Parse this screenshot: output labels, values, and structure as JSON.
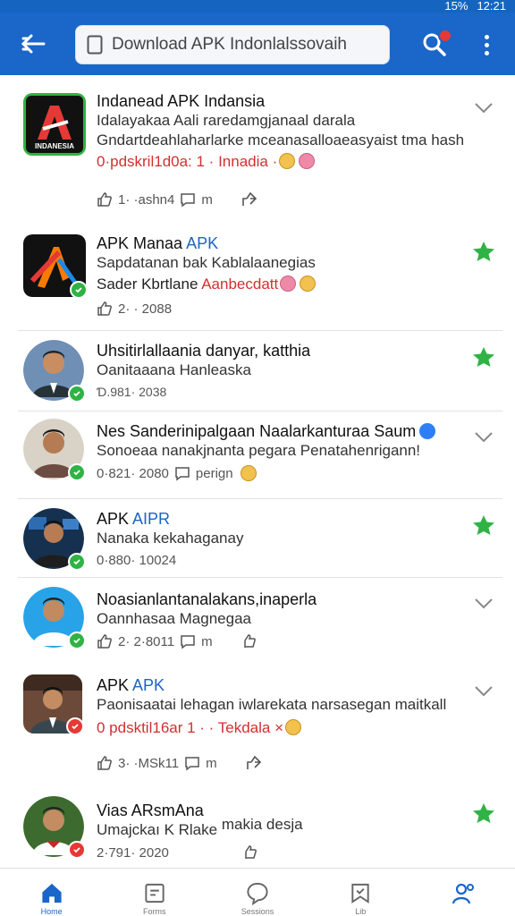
{
  "status_bar": {
    "battery": "15%",
    "time": "12:21"
  },
  "header": {
    "search_value": "Download APK Indonlalssovaih",
    "colors": {
      "bar": "#1a66c9",
      "badge": "#e53935"
    }
  },
  "feed": [
    {
      "title": "Indanead APK Indansia",
      "title_accent": "",
      "line1": "Idalayakaa Aali raredamgjanaal darala",
      "line2": "Gndartdeahlaharlarke mceanasalloaeasyaist tma hash",
      "line3": "0·pdskril1d0a: 1 · Innadia ·",
      "likes": "1· ·ashn4",
      "comments": "m",
      "logo_text": "INDANESIA",
      "right_icon": "chevron-down"
    },
    {
      "title": "APK Manaa ",
      "title_accent": "APK",
      "line1": "Sapdatanan bak Kablalaanegias",
      "line2_dark": "Sader Kbrtlane ",
      "line2_red": "Aanbecdatt",
      "likes": "2· · 2088",
      "right_icon": "star"
    },
    {
      "title": "Uhsitirlallaania danyar, katthia",
      "line1": "Oanitaaana Hanleaska",
      "likes": "Ɗ.981· 2038",
      "right_icon": "star"
    },
    {
      "title": "Nes Sanderinipalgaan Naalarkanturaa Saum",
      "line1": "Sonoeaa nanakjnanta pegara Penatahenrigann!",
      "likes": "0·821· 2080",
      "comments": "perign",
      "right_icon": "chevron-down"
    },
    {
      "title": "APK ",
      "title_accent": "AIPR",
      "line1": "Nanaka kekahaganay",
      "likes": "0·880· 10024",
      "right_icon": "star"
    },
    {
      "title": "Noasianlantanalakans,inaperla",
      "line1": "Oannhasaa Magnegaa",
      "likes": "2· 2·8011",
      "comments": "m",
      "right_icon": "chevron-down"
    },
    {
      "title": "APK ",
      "title_accent": "APK",
      "line1": "Paonisaatai lehagan iwlarekata narsasegan maitkall",
      "line2": "0 pdsktil16ar 1 ·  · Tekdala ×",
      "likes": "3· ·MSk11",
      "comments": "m",
      "right_icon": "chevron-down"
    },
    {
      "title": "Vias ARsmAna",
      "line1": "Umajckaı K Rlake",
      "line1_extra": "makia desja",
      "likes": "2·791· 2020",
      "right_icon": "star"
    }
  ],
  "bottom_nav": [
    {
      "label": "Home",
      "icon": "home"
    },
    {
      "label": "Forms",
      "icon": "calendar"
    },
    {
      "label": "Sessions",
      "icon": "chat"
    },
    {
      "label": "Lib",
      "icon": "bookmark"
    },
    {
      "label": "",
      "icon": "profile"
    }
  ]
}
